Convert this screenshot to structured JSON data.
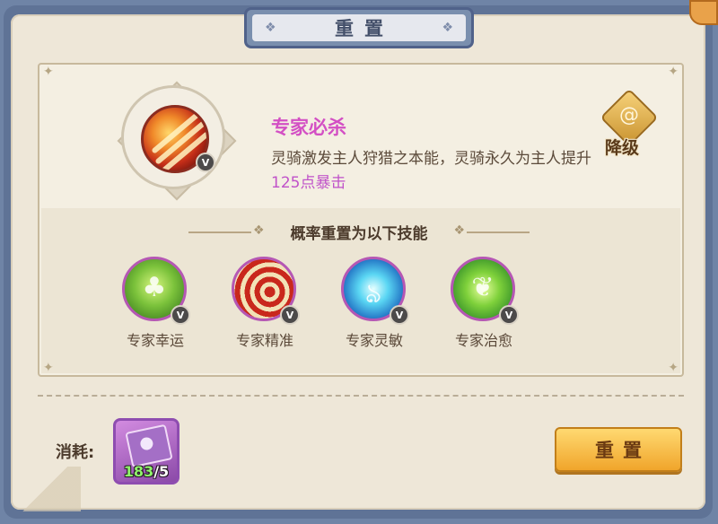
{
  "title": "重置",
  "main_skill": {
    "name": "专家必杀",
    "description_prefix": "灵骑激发主人狩猎之本能，灵骑永久为主人提升",
    "description_highlight": "125点暴击",
    "badge": "V",
    "icon": "claw-strike-icon"
  },
  "downgrade_button": {
    "label": "降级",
    "icon": "spiral-icon"
  },
  "probability_header": "概率重置为以下技能",
  "possible_skills": [
    {
      "name": "专家幸运",
      "badge": "V",
      "icon": "clover-icon"
    },
    {
      "name": "专家精准",
      "badge": "V",
      "icon": "target-icon"
    },
    {
      "name": "专家灵敏",
      "badge": "V",
      "icon": "wind-swirl-icon"
    },
    {
      "name": "专家治愈",
      "badge": "V",
      "icon": "sprout-icon"
    }
  ],
  "cost": {
    "label": "消耗:",
    "item_icon": "skill-book-icon",
    "owned": "183",
    "separator": "/",
    "required": "5"
  },
  "reset_button": {
    "label": "重置"
  },
  "colors": {
    "highlight": "#c052c9",
    "skill_name": "#d34fc4",
    "owned_count": "#8ff36a",
    "button_gold": "#f0a52b"
  }
}
